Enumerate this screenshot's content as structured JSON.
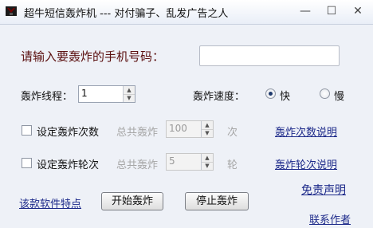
{
  "window": {
    "title": "超牛短信轰炸机 --- 对付骗子、乱发广告之人",
    "icons": {
      "app": "app-icon",
      "minimize": "minimize-icon",
      "maximize": "maximize-icon",
      "close": "close-icon"
    },
    "symbols": {
      "minimize": "—",
      "maximize": "☐",
      "close": "✕"
    }
  },
  "form": {
    "prompt": "请输入要轰炸的手机号码：",
    "phone_value": "",
    "threads": {
      "label": "轰炸线程：",
      "value": "1"
    },
    "speed": {
      "label": "轰炸速度：",
      "options": [
        {
          "label": "快",
          "selected": true
        },
        {
          "label": "慢",
          "selected": false
        }
      ]
    },
    "count_row": {
      "checkbox_label": "设定轰炸次数",
      "checked": false,
      "total_label": "总共轰炸",
      "value": "100",
      "unit": "次",
      "help_link": "轰炸次数说明"
    },
    "rounds_row": {
      "checkbox_label": "设定轰炸轮次",
      "checked": false,
      "total_label": "总共轰炸",
      "value": "5",
      "unit": "轮",
      "help_link": "轰炸轮次说明"
    }
  },
  "footer": {
    "features_link": "该款软件特点",
    "start_button": "开始轰炸",
    "stop_button": "停止轰炸",
    "disclaimer_link": "免责声明",
    "contact_link": "联系作者"
  },
  "colors": {
    "prompt": "#5b1010",
    "link": "#1d2a8a",
    "background": "#eef1f7"
  }
}
